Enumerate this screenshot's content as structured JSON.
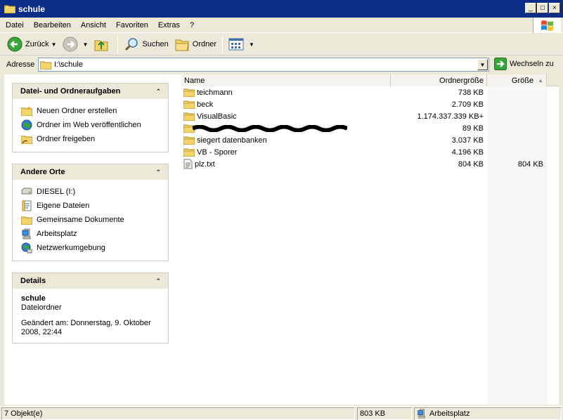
{
  "window": {
    "title": "schule",
    "controls": [
      "_",
      "□",
      "×"
    ]
  },
  "menu": [
    "Datei",
    "Bearbeiten",
    "Ansicht",
    "Favoriten",
    "Extras",
    "?"
  ],
  "toolbar": {
    "back_label": "Zurück",
    "search_label": "Suchen",
    "folders_label": "Ordner"
  },
  "address": {
    "label": "Adresse",
    "value": "I:\\schule",
    "go_label": "Wechseln zu"
  },
  "taskpane": {
    "tasks_title": "Datei- und Ordneraufgaben",
    "tasks": [
      {
        "label": "Neuen Ordner erstellen",
        "icon": "new-folder-icon"
      },
      {
        "label": "Ordner im Web veröffentlichen",
        "icon": "publish-web-icon"
      },
      {
        "label": "Ordner freigeben",
        "icon": "share-folder-icon"
      }
    ],
    "places_title": "Andere Orte",
    "places": [
      {
        "label": "DIESEL (I:)",
        "icon": "drive-icon"
      },
      {
        "label": "Eigene Dateien",
        "icon": "documents-icon"
      },
      {
        "label": "Gemeinsame Dokumente",
        "icon": "folder-icon"
      },
      {
        "label": "Arbeitsplatz",
        "icon": "computer-icon"
      },
      {
        "label": "Netzwerkumgebung",
        "icon": "network-icon"
      }
    ],
    "details_title": "Details",
    "details": {
      "name": "schule",
      "type": "Dateiordner",
      "modified": "Geändert am: Donnerstag, 9. Oktober 2008, 22:44"
    }
  },
  "filelist": {
    "columns": {
      "name": "Name",
      "size": "Ordnergröße",
      "gr": "Größe"
    },
    "rows": [
      {
        "name": "teichmann",
        "size": "738 KB",
        "gr": "",
        "type": "folder"
      },
      {
        "name": "beck",
        "size": "2.709 KB",
        "gr": "",
        "type": "folder"
      },
      {
        "name": "VisualBasic",
        "size": "1.174.337.339 KB+",
        "gr": "",
        "type": "folder"
      },
      {
        "name": "",
        "size": "89 KB",
        "gr": "",
        "type": "folder",
        "redacted": true
      },
      {
        "name": "siegert datenbanken",
        "size": "3.037 KB",
        "gr": "",
        "type": "folder"
      },
      {
        "name": "VB - Sporer",
        "size": "4.196 KB",
        "gr": "",
        "type": "folder"
      },
      {
        "name": "plz.txt",
        "size": "804 KB",
        "gr": "804 KB",
        "type": "text-file"
      }
    ]
  },
  "status": {
    "count": "7 Objekt(e)",
    "size": "803 KB",
    "zone": "Arbeitsplatz"
  }
}
